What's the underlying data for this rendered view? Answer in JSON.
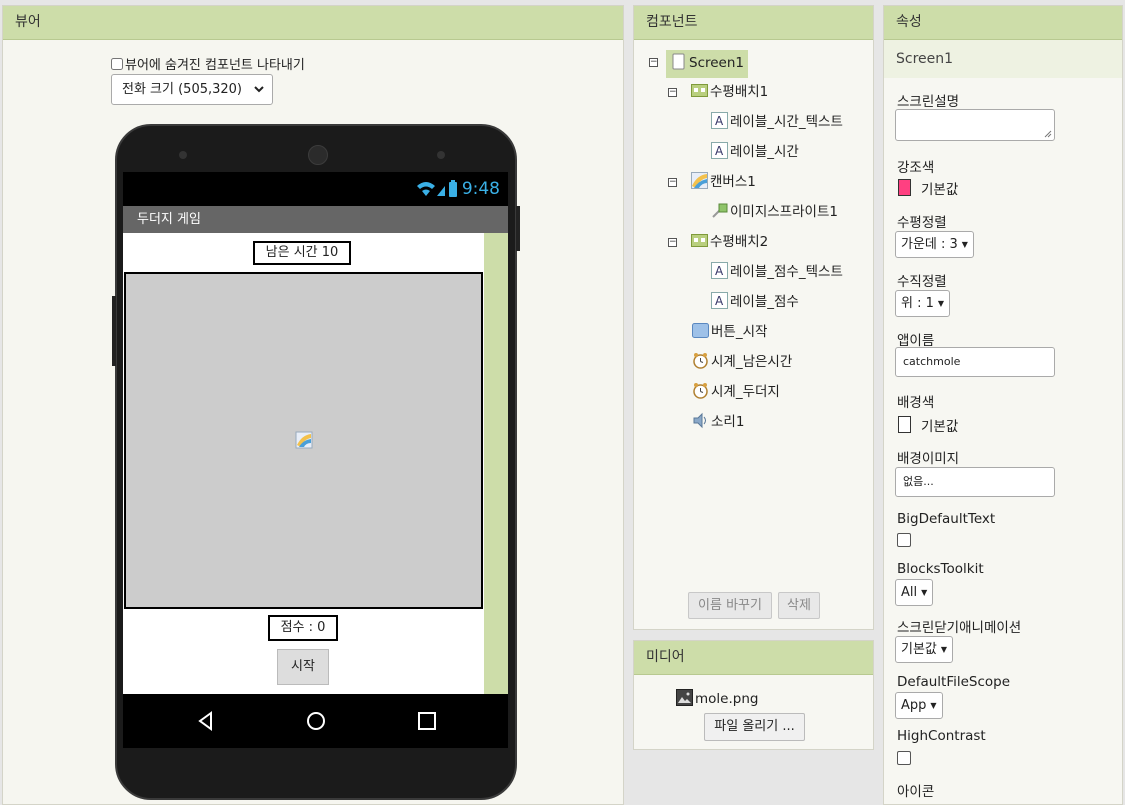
{
  "viewer": {
    "title": "뷰어",
    "hidden_checkbox_label": "뷰어에 숨겨진 컴포넌트 나타내기",
    "size_select": "전화 크기 (505,320)",
    "phone": {
      "time": "9:48",
      "app_title": "두더지 게임",
      "timer_label": "남은 시간   10",
      "score_label": "점수 :    0",
      "start_button": "시작"
    }
  },
  "components": {
    "title": "컴포넌트",
    "tree": [
      {
        "label": "Screen1",
        "icon": "screen-icon"
      },
      {
        "label": "수평배치1",
        "icon": "horizontal-arrangement-icon"
      },
      {
        "label": "레이블_시간_텍스트",
        "icon": "label-icon"
      },
      {
        "label": "레이블_시간",
        "icon": "label-icon"
      },
      {
        "label": "캔버스1",
        "icon": "canvas-icon"
      },
      {
        "label": "이미지스프라이트1",
        "icon": "image-sprite-icon"
      },
      {
        "label": "수평배치2",
        "icon": "horizontal-arrangement-icon"
      },
      {
        "label": "레이블_점수_텍스트",
        "icon": "label-icon"
      },
      {
        "label": "레이블_점수",
        "icon": "label-icon"
      },
      {
        "label": "버튼_시작",
        "icon": "button-icon"
      },
      {
        "label": "시계_남은시간",
        "icon": "clock-icon"
      },
      {
        "label": "시계_두더지",
        "icon": "clock-icon"
      },
      {
        "label": "소리1",
        "icon": "sound-icon"
      }
    ],
    "rename_button": "이름 바꾸기",
    "delete_button": "삭제"
  },
  "media": {
    "title": "미디어",
    "file": "mole.png",
    "upload_button": "파일 올리기 ..."
  },
  "properties": {
    "title": "속성",
    "screen": "Screen1",
    "screen_desc_label": "스크린설명",
    "accent_label": "강조색",
    "accent_value": "기본값",
    "accent_color": "#ff4081",
    "halign_label": "수평정렬",
    "halign_value": "가운데 : 3",
    "valign_label": "수직정렬",
    "valign_value": "위 : 1",
    "appname_label": "앱이름",
    "appname_value": "catchmole",
    "bgcolor_label": "배경색",
    "bgcolor_value": "기본값",
    "bgimage_label": "배경이미지",
    "bgimage_value": "없음...",
    "bigdefault_label": "BigDefaultText",
    "blockstoolkit_label": "BlocksToolkit",
    "blockstoolkit_value": "All",
    "closeanim_label": "스크린닫기애니메이션",
    "closeanim_value": "기본값",
    "filescope_label": "DefaultFileScope",
    "filescope_value": "App",
    "highcontrast_label": "HighContrast",
    "icon_label": "아이콘"
  }
}
